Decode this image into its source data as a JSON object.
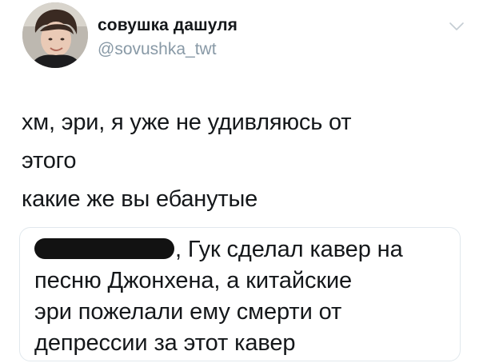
{
  "author": {
    "display_name": "совушка дашуля",
    "handle": "@sovushka_twt"
  },
  "icons": {
    "avatar": "profile-photo",
    "menu": "chevron-down-icon"
  },
  "tweet": {
    "lines": [
      "хм, эри, я уже не удивляюсь от",
      "этого",
      "какие же вы ебанутые"
    ]
  },
  "quoted_tweet": {
    "first_line_after_redaction": ", Гук сделал кавер на",
    "lines": [
      "песню Джонхена, а китайские",
      "эри пожелали ему смерти от",
      "депрессии за этот кавер"
    ]
  },
  "colors": {
    "text": "#14171a",
    "secondary": "#8899a6",
    "border": "#e1e8ed",
    "redaction": "#121212"
  }
}
